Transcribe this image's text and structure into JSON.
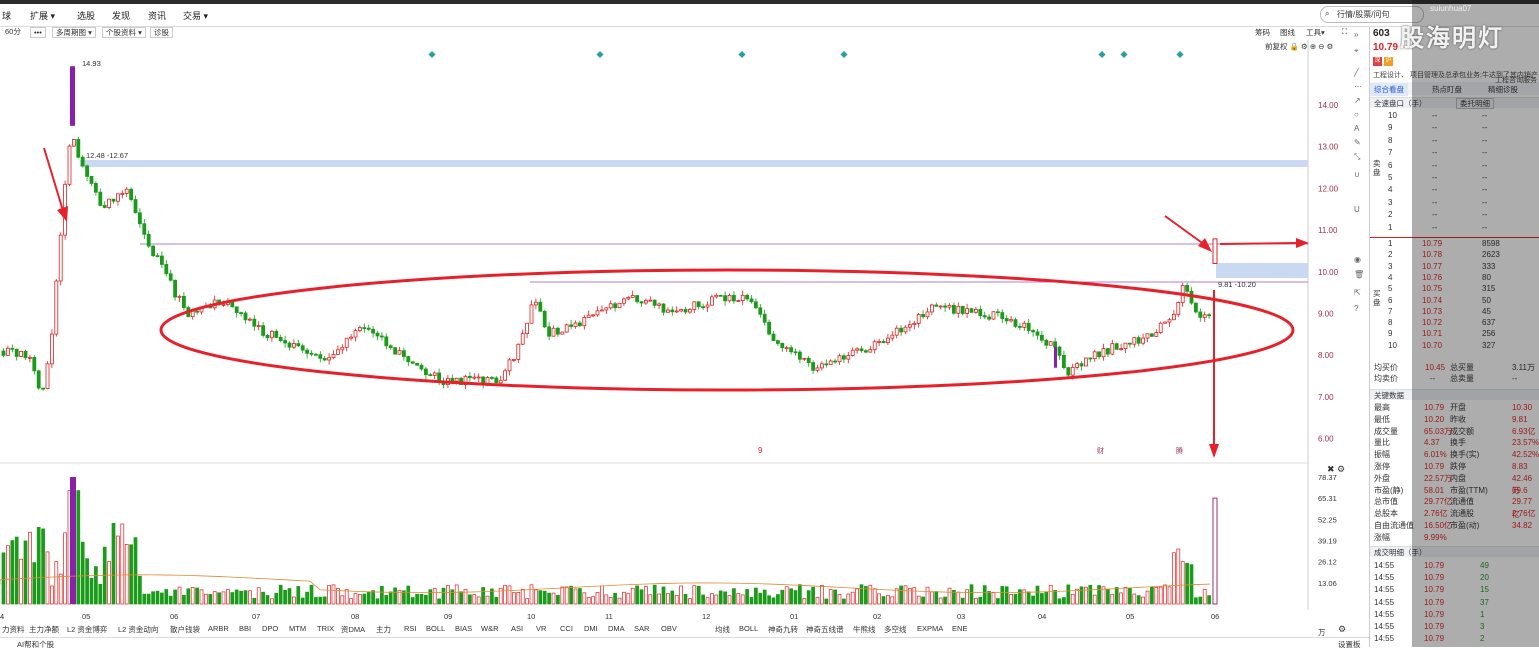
{
  "menu": [
    "球",
    "扩展",
    "选股",
    "发现",
    "资讯",
    "交易"
  ],
  "search_placeholder": "行情/股票/问句",
  "toolbar": {
    "period": "60分",
    "more": "•••",
    "multi_period": "多周期图",
    "stock_info": "个股资料",
    "diagnose": "诊股",
    "right_items": [
      "筹码",
      "图线",
      "工具",
      "前复权"
    ]
  },
  "price_axis": [
    "14.00",
    "13.00",
    "12.00",
    "11.00",
    "10.00",
    "9.00",
    "8.00",
    "7.00",
    "6.00"
  ],
  "volume_axis": [
    "78.37",
    "65.31",
    "52.25",
    "39.19",
    "26.12",
    "13.06",
    "万"
  ],
  "months": [
    "4",
    "05",
    "06",
    "07",
    "08",
    "09",
    "10",
    "11",
    "12",
    "01",
    "02",
    "03",
    "04",
    "05",
    "06"
  ],
  "annotations": {
    "high": "14.93",
    "band_label": "12.48 -12.67",
    "gap_label": "9.81 -10.20",
    "mark_left": "9",
    "mark_r1": "财",
    "mark_r2": "腾"
  },
  "indicator_tabs": [
    "力资料",
    "主力净额",
    "L2 资金博弈",
    "L2 资金动向",
    "散户钱袋",
    "ARBR",
    "BBI",
    "DPO",
    "MTM",
    "TRIX",
    "资DMA",
    "主力",
    "RSI",
    "BOLL",
    "BIAS",
    "W&R",
    "ASI",
    "VR",
    "CCI",
    "DMI",
    "DMA",
    "SAR",
    "OBV",
    "均线",
    "BOLL",
    "神奇九转",
    "神奇五线谱",
    "牛熊线",
    "多空线",
    "EXPMA",
    "ENE"
  ],
  "bottom_left": "AI帮和个股",
  "bottom_right": "设置板",
  "right_panel": {
    "code": "603",
    "price": "10.79",
    "tags": [
      "深",
      "沪"
    ],
    "desc": "工程设计、 项目管理及总承包业务;牛达到了其内销产",
    "desc2": "工程咨询服务",
    "tabs": [
      "综合看盘",
      "热点盯盘",
      "精细诊股"
    ],
    "order_header": "全速盘口（手）",
    "order_btn": "委托明细",
    "sell_rows": [
      {
        "n": "10",
        "p": "--",
        "v": "--"
      },
      {
        "n": "9",
        "p": "--",
        "v": "--"
      },
      {
        "n": "8",
        "p": "--",
        "v": "--"
      },
      {
        "n": "7",
        "p": "--",
        "v": "--"
      },
      {
        "n": "6",
        "p": "--",
        "v": "--"
      },
      {
        "n": "5",
        "p": "--",
        "v": "--"
      },
      {
        "n": "4",
        "p": "--",
        "v": "--"
      },
      {
        "n": "3",
        "p": "--",
        "v": "--"
      },
      {
        "n": "2",
        "p": "--",
        "v": "--"
      },
      {
        "n": "1",
        "p": "--",
        "v": "--"
      }
    ],
    "sell_label": "卖盘",
    "buy_label": "买盘",
    "buy_rows": [
      {
        "n": "1",
        "p": "10.79",
        "v": "8598"
      },
      {
        "n": "2",
        "p": "10.78",
        "v": "2623"
      },
      {
        "n": "3",
        "p": "10.77",
        "v": "333"
      },
      {
        "n": "4",
        "p": "10.76",
        "v": "80"
      },
      {
        "n": "5",
        "p": "10.75",
        "v": "315"
      },
      {
        "n": "6",
        "p": "10.74",
        "v": "50"
      },
      {
        "n": "7",
        "p": "10.73",
        "v": "45"
      },
      {
        "n": "8",
        "p": "10.72",
        "v": "637"
      },
      {
        "n": "9",
        "p": "10.71",
        "v": "256"
      },
      {
        "n": "10",
        "p": "10.70",
        "v": "327"
      }
    ],
    "avg_buy": {
      "label": "均买价",
      "value": "10.45",
      "label2": "总买量",
      "value2": "3.11万"
    },
    "avg_sell": {
      "label": "均卖价",
      "value": "--",
      "label2": "总卖量",
      "value2": "--"
    },
    "key_header": "关键数据",
    "key_rows": [
      [
        "最高",
        "10.79",
        "开盘",
        "10.30"
      ],
      [
        "最低",
        "10.20",
        "昨收",
        "9.81"
      ],
      [
        "成交量",
        "65.03万",
        "成交额",
        "6.93亿"
      ],
      [
        "量比",
        "4.37",
        "换手",
        "23.57%"
      ],
      [
        "振幅",
        "6.01%",
        "换手(实)",
        "42.52%"
      ],
      [
        "涨停",
        "10.79",
        "跌停",
        "8.83"
      ],
      [
        "外盘",
        "22.57万",
        "内盘",
        "42.46万"
      ],
      [
        "市盈(静)",
        "58.01",
        "市盈(TTM)",
        "69.6"
      ],
      [
        "总市值",
        "29.77亿",
        "流通值",
        "29.77亿"
      ],
      [
        "总股本",
        "2.76亿",
        "流通股",
        "2.76亿"
      ],
      [
        "自由流通值",
        "16.50亿",
        "市盈(动)",
        "34.82"
      ],
      [
        "涨幅",
        "9.99%",
        "",
        ""
      ]
    ],
    "trade_header": "成交明细（手）",
    "trades": [
      {
        "t": "14:55",
        "p": "10.79",
        "v": "49"
      },
      {
        "t": "14:55",
        "p": "10.79",
        "v": "20"
      },
      {
        "t": "14:55",
        "p": "10.79",
        "v": "15"
      },
      {
        "t": "14:55",
        "p": "10.79",
        "v": "37"
      },
      {
        "t": "14:55",
        "p": "10.79",
        "v": "1"
      },
      {
        "t": "14:55",
        "p": "10.79",
        "v": "3"
      },
      {
        "t": "14:55",
        "p": "10.79",
        "v": "2"
      }
    ]
  },
  "watermark": "股海明灯",
  "watermark_user": "suiunhua07",
  "colors": {
    "up": "#e02020",
    "down": "#1a9c1a",
    "annotation": "#e8202a",
    "band": "#c9d9f2",
    "line": "#b07fd0"
  }
}
